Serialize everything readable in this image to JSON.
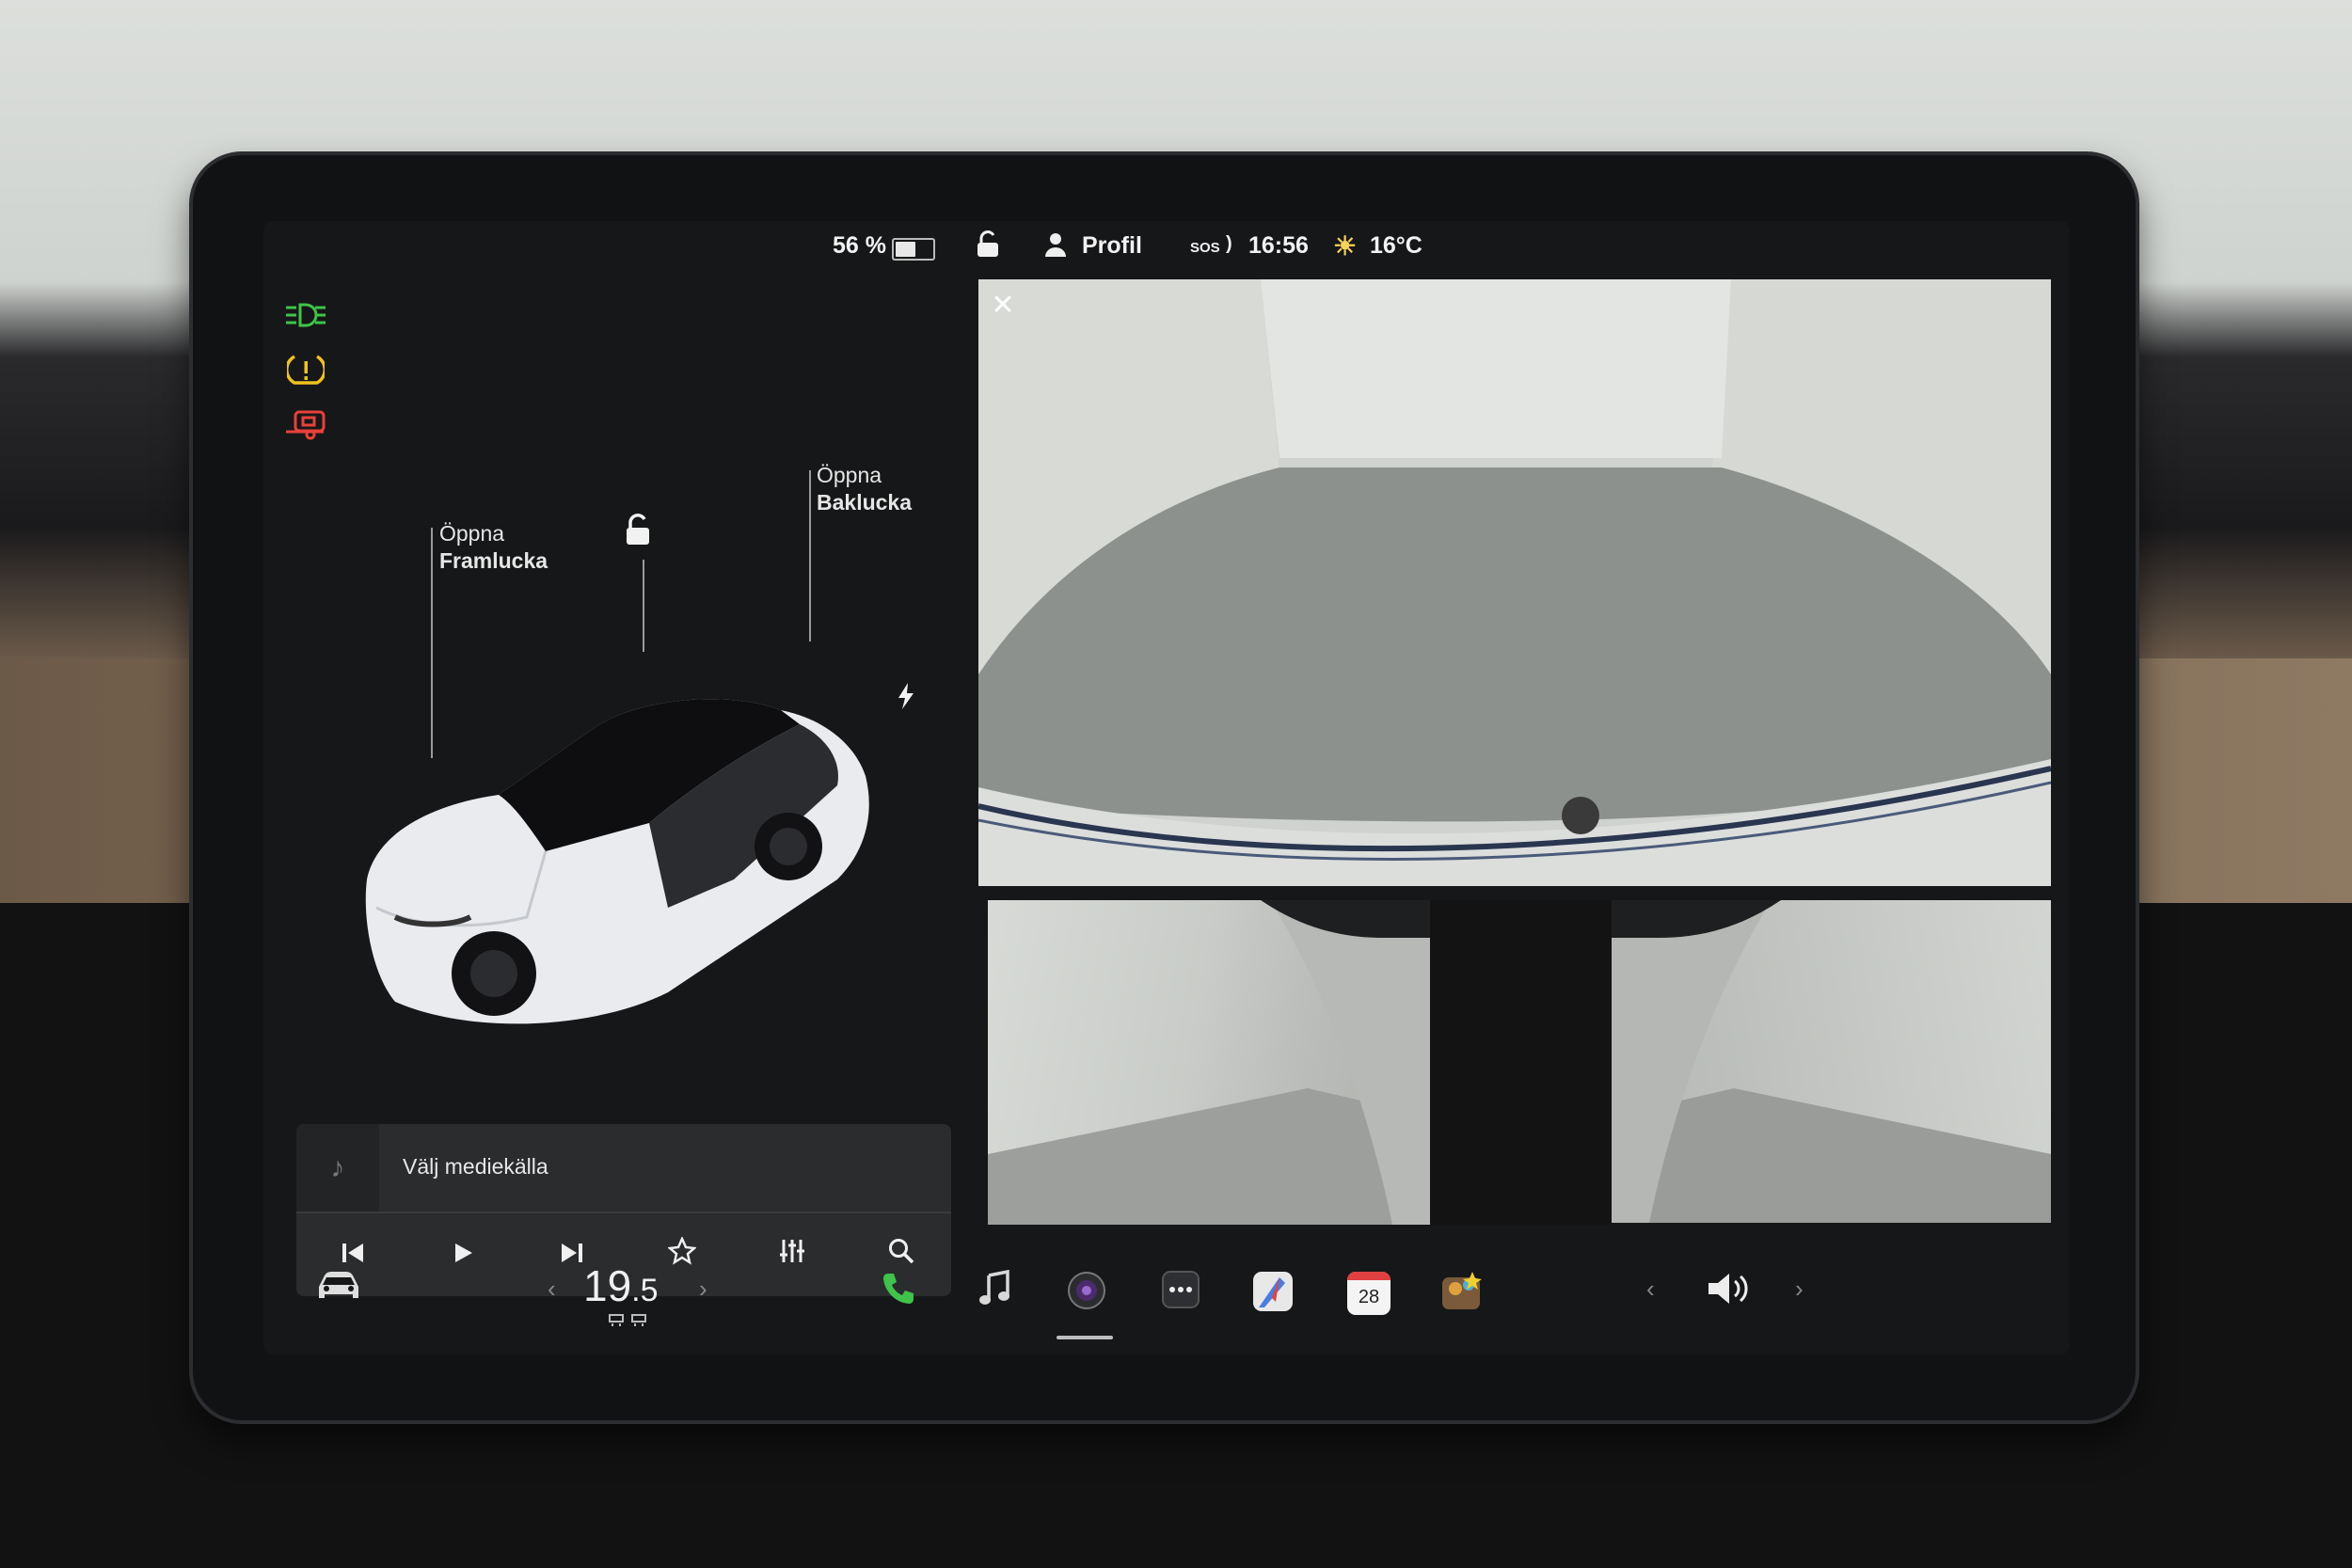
{
  "status": {
    "battery_percent": "56 %",
    "battery_level": 0.56,
    "profile_label": "Profil",
    "sos_label": "SOS",
    "time": "16:56",
    "temperature": "16°C"
  },
  "telltales": [
    {
      "name": "parking-lights",
      "glyph": "≣D≡",
      "color": "#3ec44a"
    },
    {
      "name": "tire-pressure-warning",
      "glyph": "(!)",
      "color": "#f0c21e"
    },
    {
      "name": "trailer-warning",
      "glyph": "⛟",
      "color": "#e8413a"
    }
  ],
  "car": {
    "frunk": {
      "line1": "Öppna",
      "line2": "Framlucka"
    },
    "trunk": {
      "line1": "Öppna",
      "line2": "Baklucka"
    }
  },
  "media": {
    "source_label": "Välj mediekälla"
  },
  "climate": {
    "temp_whole": "19",
    "temp_decimal": ".5"
  },
  "dock": {
    "calendar_day": "28"
  },
  "colors": {
    "screen_bg": "#161718",
    "accent_green": "#3ec44a",
    "warning_yellow": "#f0c21e",
    "alert_red": "#e8413a"
  }
}
